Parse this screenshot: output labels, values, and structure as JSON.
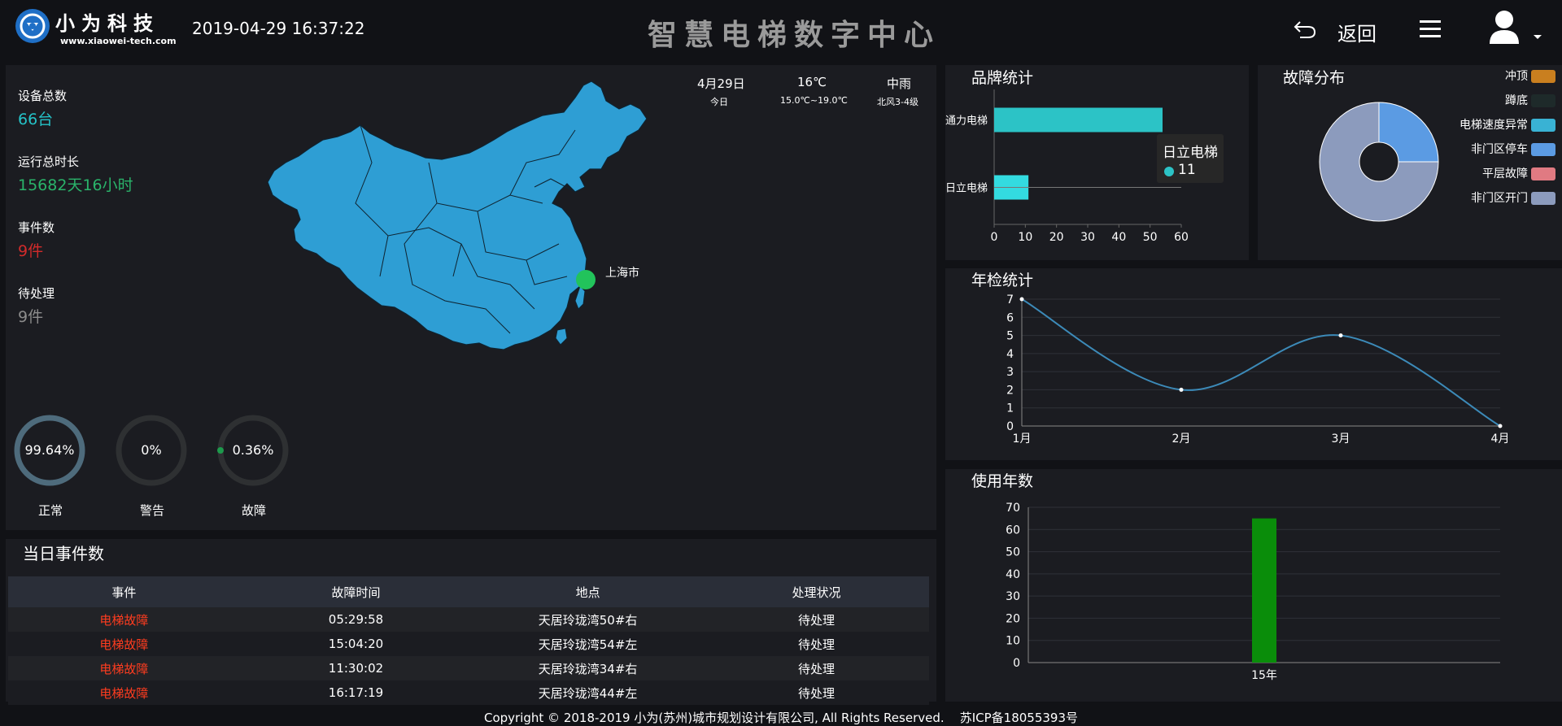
{
  "header": {
    "logo_name": "小为科技",
    "logo_url": "www.xiaowei-tech.com",
    "datetime": "2019-04-29 16:37:22",
    "title": "智慧电梯数字中心",
    "back_label": "返回"
  },
  "stats": [
    {
      "label": "设备总数",
      "value": "66台",
      "color": "#24c3c8"
    },
    {
      "label": "运行总时长",
      "value": "15682天16小时",
      "color": "#2ab36a"
    },
    {
      "label": "事件数",
      "value": "9件",
      "color": "#d22b2b"
    },
    {
      "label": "待处理",
      "value": "9件",
      "color": "#8c8c8c"
    }
  ],
  "weather": [
    {
      "top": "4月29日",
      "bottom": "今日"
    },
    {
      "top": "16℃",
      "bottom": "15.0℃~19.0℃"
    },
    {
      "top": "中雨",
      "bottom": "北风3-4级"
    }
  ],
  "map": {
    "marker_label": "上海市",
    "fill": "#2e9ed4",
    "marker_color": "#22c35b"
  },
  "rings": [
    {
      "value": "99.64%",
      "label": "正常",
      "percent": 99.64,
      "color": "#4e6b7c"
    },
    {
      "value": "0%",
      "label": "警告",
      "percent": 0,
      "color": "#2e3032"
    },
    {
      "value": "0.36%",
      "label": "故障",
      "percent": 0.36,
      "color": "#1d9a4c"
    }
  ],
  "events": {
    "title": "当日事件数",
    "columns": [
      "事件",
      "故障时间",
      "地点",
      "处理状况"
    ],
    "rows": [
      [
        "电梯故障",
        "05:29:58",
        "天居玲珑湾50#右",
        "待处理"
      ],
      [
        "电梯故障",
        "15:04:20",
        "天居玲珑湾54#左",
        "待处理"
      ],
      [
        "电梯故障",
        "11:30:02",
        "天居玲珑湾34#右",
        "待处理"
      ],
      [
        "电梯故障",
        "16:17:19",
        "天居玲珑湾44#左",
        "待处理"
      ]
    ]
  },
  "footer": "Copyright © 2018-2019 小为(苏州)城市规划设计有限公司, All Rights Reserved.    苏ICP备18055393号",
  "panels": {
    "brand": "品牌统计",
    "fault": "故障分布",
    "annual": "年检统计",
    "years": "使用年数"
  },
  "chart_data": [
    {
      "type": "bar",
      "orientation": "horizontal",
      "categories": [
        "通力电梯",
        "日立电梯"
      ],
      "values": [
        54,
        11
      ],
      "colors": [
        "#2cc3c6",
        "#33dbe0"
      ],
      "xlim": [
        0,
        60
      ],
      "xticks": [
        0,
        10,
        20,
        30,
        40,
        50,
        60
      ],
      "tooltip": {
        "name": "日立电梯",
        "value": "11"
      }
    },
    {
      "type": "pie",
      "donut": true,
      "labels": [
        "冲顶",
        "蹲底",
        "电梯速度异常",
        "非门区停车",
        "平层故障",
        "非门区开门"
      ],
      "colors": [
        "#c97f1f",
        "#1e2a2a",
        "#39b2d4",
        "#5b9be3",
        "#e07a82",
        "#8c9bbd"
      ],
      "values": [
        0,
        0,
        0,
        1,
        0,
        3
      ]
    },
    {
      "type": "line",
      "categories": [
        "1月",
        "2月",
        "3月",
        "4月"
      ],
      "values": [
        7,
        2,
        5,
        0
      ],
      "ylim": [
        0,
        7
      ],
      "yticks": [
        0,
        1,
        2,
        3,
        4,
        5,
        6,
        7
      ],
      "color": "#3c8ab8"
    },
    {
      "type": "bar",
      "categories": [
        "15年"
      ],
      "values": [
        65
      ],
      "ylim": [
        0,
        70
      ],
      "yticks": [
        0,
        10,
        20,
        30,
        40,
        50,
        60,
        70
      ],
      "color": "#0a8d0a"
    }
  ]
}
